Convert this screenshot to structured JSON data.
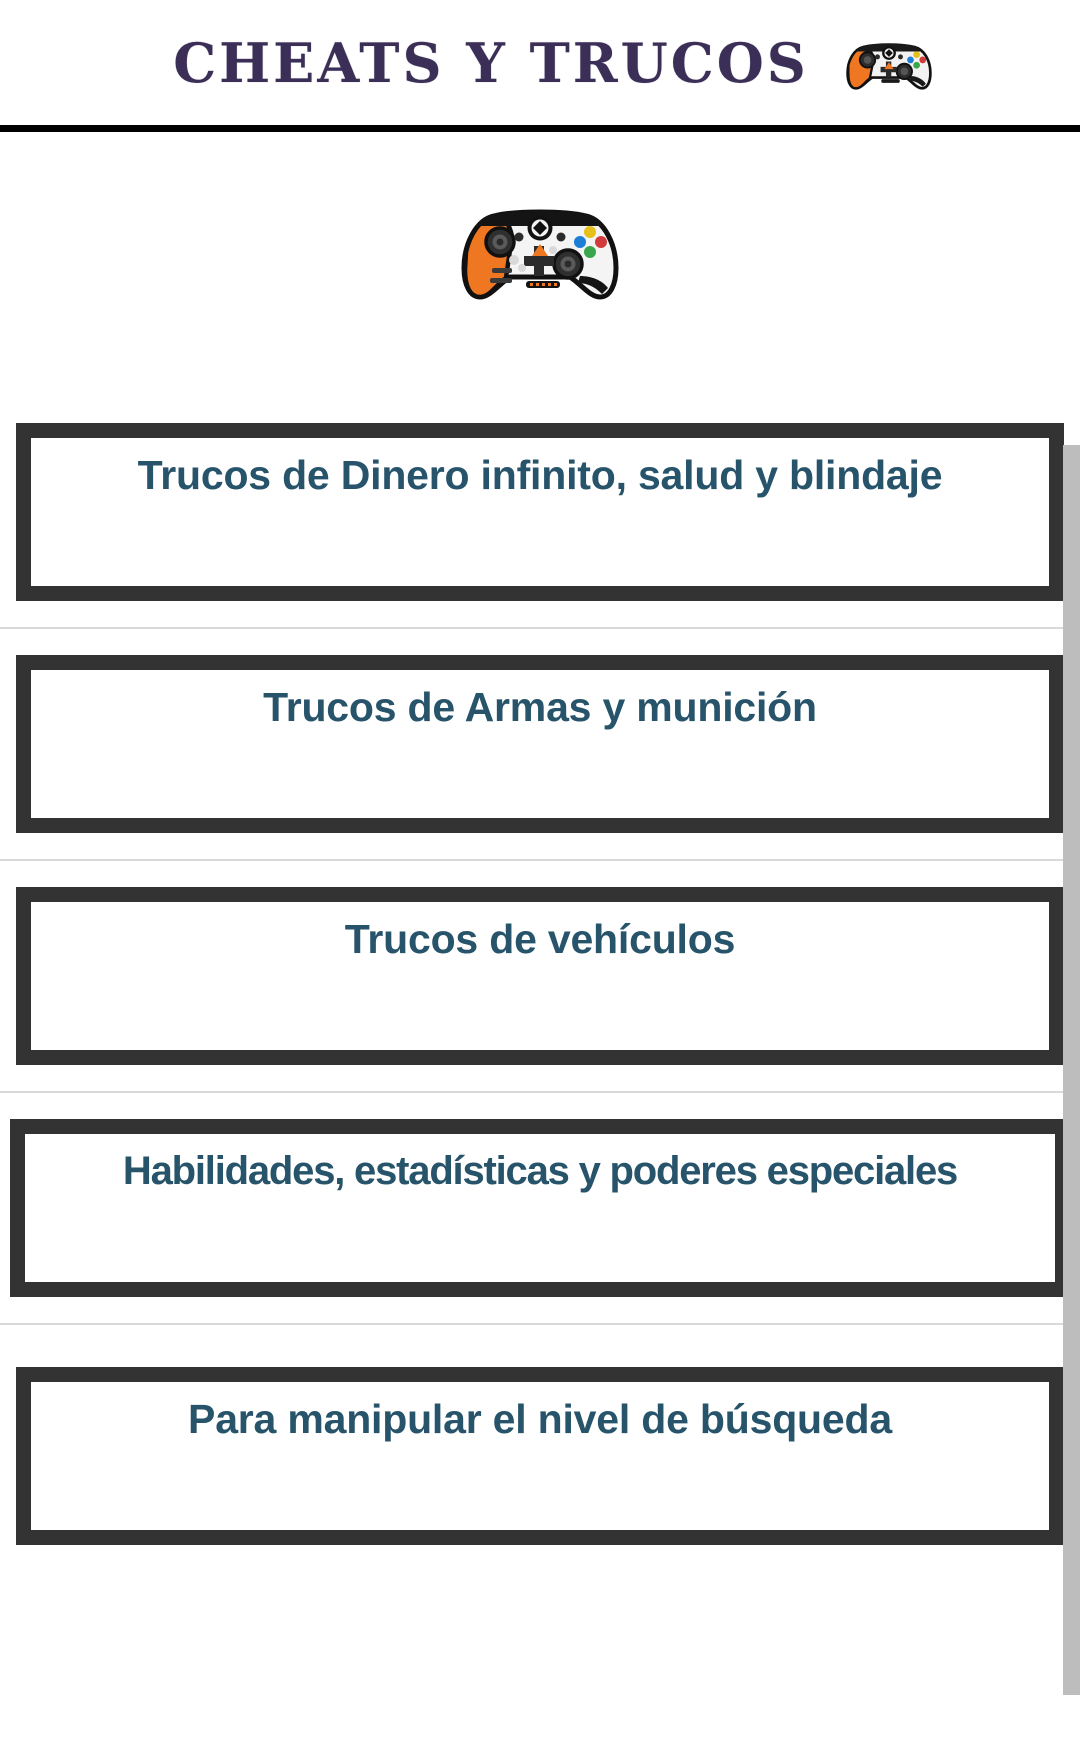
{
  "header": {
    "title": "CHEATS Y TRUCOS",
    "title_color": "#3b2f57",
    "icon": "xbox-controller-icon"
  },
  "hero": {
    "icon": "xbox-controller-image"
  },
  "theme": {
    "card_border": "#333333",
    "card_text": "#27546b",
    "divider": "#000000",
    "scrollbar": "#bdbdbd",
    "background": "#ffffff"
  },
  "list": {
    "items": [
      {
        "label": "Trucos de Dinero infinito, salud y blindaje"
      },
      {
        "label": "Trucos de Armas y munición"
      },
      {
        "label": "Trucos de vehículos"
      },
      {
        "label": "Habilidades, estadísticas y poderes especiales"
      },
      {
        "label": "Para manipular el nivel de búsqueda"
      }
    ]
  }
}
